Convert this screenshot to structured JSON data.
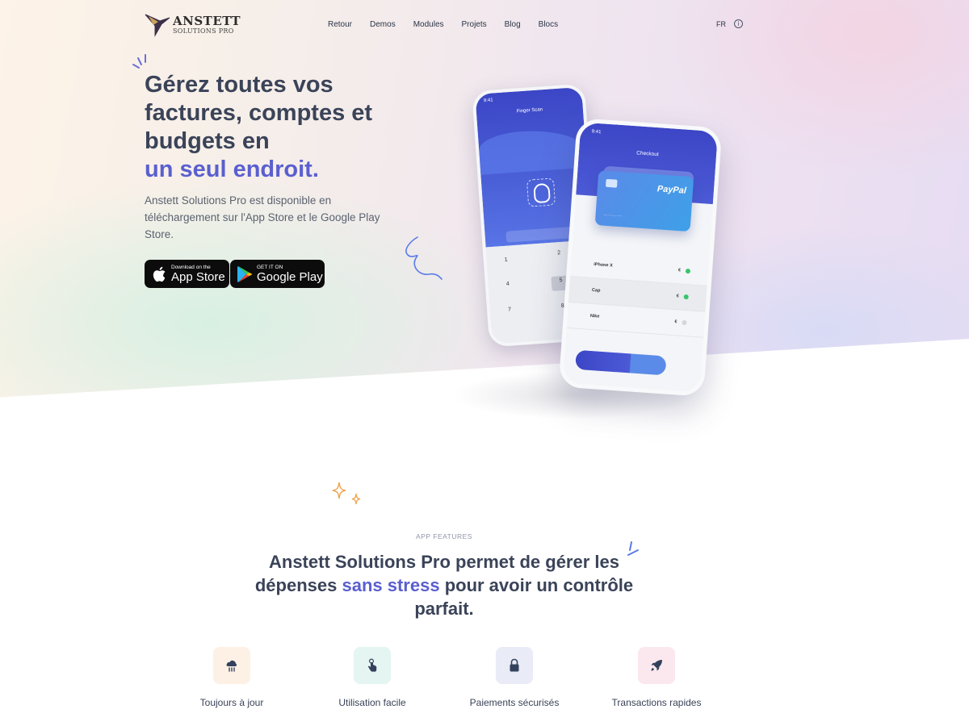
{
  "brand": {
    "name": "ANSTETT",
    "tagline": "SOLUTIONS PRO"
  },
  "nav": {
    "links": [
      "Retour",
      "Demos",
      "Modules",
      "Projets",
      "Blog",
      "Blocs"
    ],
    "language": "FR",
    "info_icon": "info-icon"
  },
  "hero": {
    "title_line1": "Gérez toutes vos",
    "title_line2": "factures, comptes et",
    "title_line3": "budgets en",
    "title_accent": "un seul endroit.",
    "description": "Anstett Solutions Pro est disponible en téléchargement sur l'App Store et le Google Play Store.",
    "app_store": {
      "small": "Download on the",
      "big": "App Store",
      "icon": "apple-icon"
    },
    "google_play": {
      "small": "GET IT ON",
      "big": "Google Play",
      "icon": "google-play-icon"
    }
  },
  "phones": {
    "back": {
      "title": "Finger Scan"
    },
    "front": {
      "title": "Checkout",
      "card_brand": "PayPal"
    }
  },
  "features": {
    "eyebrow": "APP FEATURES",
    "title_part1": "Anstett Solutions Pro permet de gérer les dépenses",
    "title_accent": "sans stress",
    "title_part2": "pour avoir un contrôle parfait.",
    "items": [
      {
        "label": "Toujours à jour",
        "icon": "cloud-sync-icon",
        "tile_color": "#fdf1e6"
      },
      {
        "label": "Utilisation facile",
        "icon": "tap-hand-icon",
        "tile_color": "#e5f5f1"
      },
      {
        "label": "Paiements sécurisés",
        "icon": "lock-icon",
        "tile_color": "#e9ebf7"
      },
      {
        "label": "Transactions rapides",
        "icon": "rocket-icon",
        "tile_color": "#fbe8ee"
      }
    ]
  },
  "colors": {
    "accent": "#5a5fcf",
    "text": "#3a4358",
    "phone_blue": "#3c46c6"
  }
}
